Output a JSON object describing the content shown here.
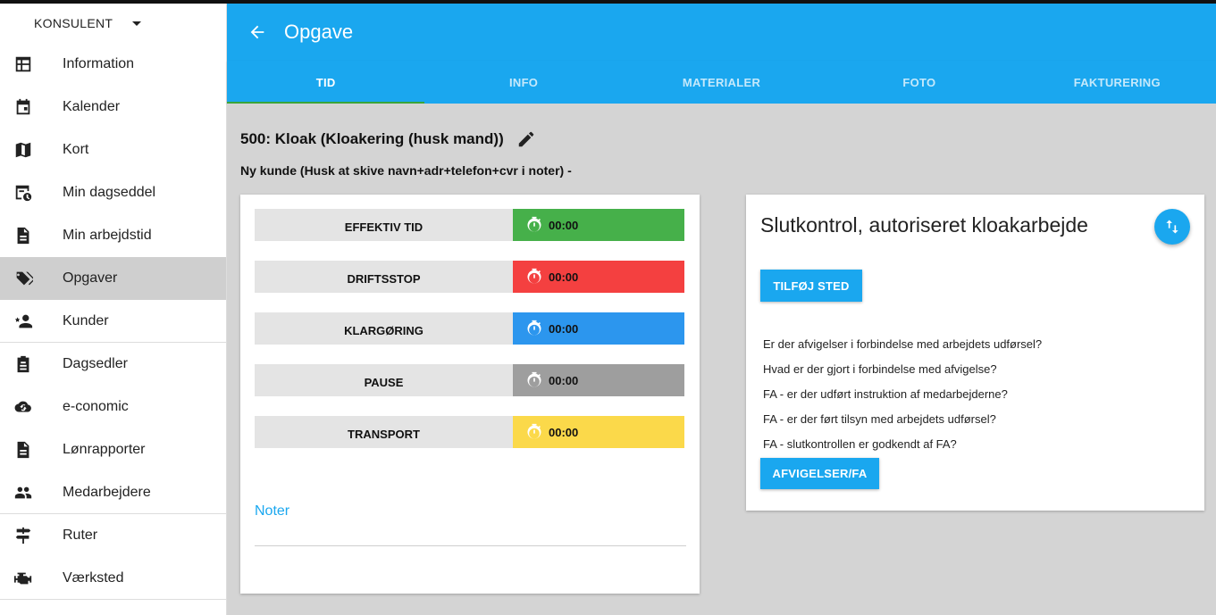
{
  "sidebar": {
    "role": "KONSULENT",
    "items": [
      {
        "label": "Information",
        "icon": "table-icon"
      },
      {
        "label": "Kalender",
        "icon": "calendar-icon"
      },
      {
        "label": "Kort",
        "icon": "map-icon"
      },
      {
        "label": "Min dagseddel",
        "icon": "timesheet-icon"
      },
      {
        "label": "Min arbejdstid",
        "icon": "document-icon"
      },
      {
        "label": "Opgaver",
        "icon": "tags-icon"
      },
      {
        "label": "Kunder",
        "icon": "person-add-icon"
      },
      {
        "label": "Dagsedler",
        "icon": "clipboard-icon"
      },
      {
        "label": "e-conomic",
        "icon": "cloud-sync-icon"
      },
      {
        "label": "Lønrapporter",
        "icon": "document-icon"
      },
      {
        "label": "Medarbejdere",
        "icon": "people-icon"
      },
      {
        "label": "Ruter",
        "icon": "signpost-icon"
      },
      {
        "label": "Værksted",
        "icon": "engine-icon"
      }
    ]
  },
  "appbar": {
    "title": "Opgave"
  },
  "tabs": [
    {
      "label": "TID",
      "active": true
    },
    {
      "label": "INFO"
    },
    {
      "label": "MATERIALER"
    },
    {
      "label": "FOTO"
    },
    {
      "label": "FAKTURERING"
    }
  ],
  "job": {
    "title": "500: Kloak (Kloakering (husk mand))",
    "subtitle": "Ny kunde (Husk at skive navn+adr+telefon+cvr i noter) -"
  },
  "time_entries": [
    {
      "label": "EFFEKTIV TID",
      "value": "00:00",
      "color": "#46b04a"
    },
    {
      "label": "DRIFTSSTOP",
      "value": "00:00",
      "color": "#f44040"
    },
    {
      "label": "KLARGØRING",
      "value": "00:00",
      "color": "#2c96ee"
    },
    {
      "label": "PAUSE",
      "value": "00:00",
      "color": "#9e9e9e"
    },
    {
      "label": "TRANSPORT",
      "value": "00:00",
      "color": "#fbd94a"
    }
  ],
  "notes": {
    "label": "Noter"
  },
  "inspection": {
    "title": "Slutkontrol, autoriseret kloakarbejde",
    "add_place_label": "TILFØJ STED",
    "questions": [
      "Er der afvigelser i forbindelse med arbejdets udførsel?",
      "Hvad er der gjort i forbindelse med afvigelse?",
      "FA - er der udført instruktion af medarbejderne?",
      "FA - er der ført tilsyn med arbejdets udførsel?",
      "FA - slutkontrollen er godkendt af FA?"
    ],
    "deviation_label": "AFVIGELSER/FA"
  },
  "colors": {
    "accent": "#1aa7ef",
    "active_tab_indicator": "#3aa53a"
  }
}
